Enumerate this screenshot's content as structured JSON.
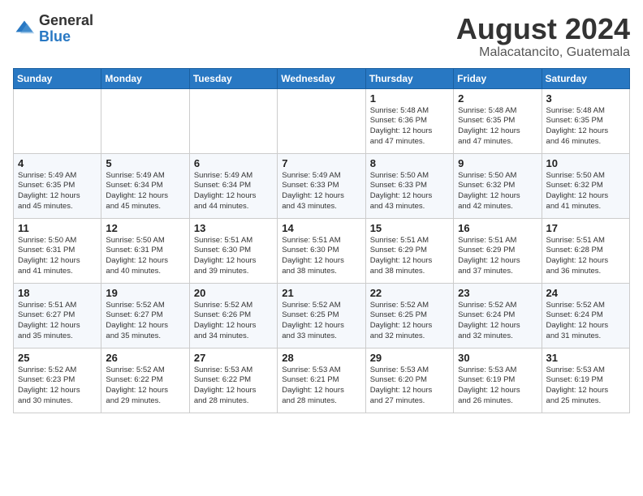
{
  "header": {
    "logo_general": "General",
    "logo_blue": "Blue",
    "month_year": "August 2024",
    "location": "Malacatancito, Guatemala"
  },
  "days_of_week": [
    "Sunday",
    "Monday",
    "Tuesday",
    "Wednesday",
    "Thursday",
    "Friday",
    "Saturday"
  ],
  "weeks": [
    [
      {
        "day": "",
        "detail": ""
      },
      {
        "day": "",
        "detail": ""
      },
      {
        "day": "",
        "detail": ""
      },
      {
        "day": "",
        "detail": ""
      },
      {
        "day": "1",
        "detail": "Sunrise: 5:48 AM\nSunset: 6:36 PM\nDaylight: 12 hours\nand 47 minutes."
      },
      {
        "day": "2",
        "detail": "Sunrise: 5:48 AM\nSunset: 6:35 PM\nDaylight: 12 hours\nand 47 minutes."
      },
      {
        "day": "3",
        "detail": "Sunrise: 5:48 AM\nSunset: 6:35 PM\nDaylight: 12 hours\nand 46 minutes."
      }
    ],
    [
      {
        "day": "4",
        "detail": "Sunrise: 5:49 AM\nSunset: 6:35 PM\nDaylight: 12 hours\nand 45 minutes."
      },
      {
        "day": "5",
        "detail": "Sunrise: 5:49 AM\nSunset: 6:34 PM\nDaylight: 12 hours\nand 45 minutes."
      },
      {
        "day": "6",
        "detail": "Sunrise: 5:49 AM\nSunset: 6:34 PM\nDaylight: 12 hours\nand 44 minutes."
      },
      {
        "day": "7",
        "detail": "Sunrise: 5:49 AM\nSunset: 6:33 PM\nDaylight: 12 hours\nand 43 minutes."
      },
      {
        "day": "8",
        "detail": "Sunrise: 5:50 AM\nSunset: 6:33 PM\nDaylight: 12 hours\nand 43 minutes."
      },
      {
        "day": "9",
        "detail": "Sunrise: 5:50 AM\nSunset: 6:32 PM\nDaylight: 12 hours\nand 42 minutes."
      },
      {
        "day": "10",
        "detail": "Sunrise: 5:50 AM\nSunset: 6:32 PM\nDaylight: 12 hours\nand 41 minutes."
      }
    ],
    [
      {
        "day": "11",
        "detail": "Sunrise: 5:50 AM\nSunset: 6:31 PM\nDaylight: 12 hours\nand 41 minutes."
      },
      {
        "day": "12",
        "detail": "Sunrise: 5:50 AM\nSunset: 6:31 PM\nDaylight: 12 hours\nand 40 minutes."
      },
      {
        "day": "13",
        "detail": "Sunrise: 5:51 AM\nSunset: 6:30 PM\nDaylight: 12 hours\nand 39 minutes."
      },
      {
        "day": "14",
        "detail": "Sunrise: 5:51 AM\nSunset: 6:30 PM\nDaylight: 12 hours\nand 38 minutes."
      },
      {
        "day": "15",
        "detail": "Sunrise: 5:51 AM\nSunset: 6:29 PM\nDaylight: 12 hours\nand 38 minutes."
      },
      {
        "day": "16",
        "detail": "Sunrise: 5:51 AM\nSunset: 6:29 PM\nDaylight: 12 hours\nand 37 minutes."
      },
      {
        "day": "17",
        "detail": "Sunrise: 5:51 AM\nSunset: 6:28 PM\nDaylight: 12 hours\nand 36 minutes."
      }
    ],
    [
      {
        "day": "18",
        "detail": "Sunrise: 5:51 AM\nSunset: 6:27 PM\nDaylight: 12 hours\nand 35 minutes."
      },
      {
        "day": "19",
        "detail": "Sunrise: 5:52 AM\nSunset: 6:27 PM\nDaylight: 12 hours\nand 35 minutes."
      },
      {
        "day": "20",
        "detail": "Sunrise: 5:52 AM\nSunset: 6:26 PM\nDaylight: 12 hours\nand 34 minutes."
      },
      {
        "day": "21",
        "detail": "Sunrise: 5:52 AM\nSunset: 6:25 PM\nDaylight: 12 hours\nand 33 minutes."
      },
      {
        "day": "22",
        "detail": "Sunrise: 5:52 AM\nSunset: 6:25 PM\nDaylight: 12 hours\nand 32 minutes."
      },
      {
        "day": "23",
        "detail": "Sunrise: 5:52 AM\nSunset: 6:24 PM\nDaylight: 12 hours\nand 32 minutes."
      },
      {
        "day": "24",
        "detail": "Sunrise: 5:52 AM\nSunset: 6:24 PM\nDaylight: 12 hours\nand 31 minutes."
      }
    ],
    [
      {
        "day": "25",
        "detail": "Sunrise: 5:52 AM\nSunset: 6:23 PM\nDaylight: 12 hours\nand 30 minutes."
      },
      {
        "day": "26",
        "detail": "Sunrise: 5:52 AM\nSunset: 6:22 PM\nDaylight: 12 hours\nand 29 minutes."
      },
      {
        "day": "27",
        "detail": "Sunrise: 5:53 AM\nSunset: 6:22 PM\nDaylight: 12 hours\nand 28 minutes."
      },
      {
        "day": "28",
        "detail": "Sunrise: 5:53 AM\nSunset: 6:21 PM\nDaylight: 12 hours\nand 28 minutes."
      },
      {
        "day": "29",
        "detail": "Sunrise: 5:53 AM\nSunset: 6:20 PM\nDaylight: 12 hours\nand 27 minutes."
      },
      {
        "day": "30",
        "detail": "Sunrise: 5:53 AM\nSunset: 6:19 PM\nDaylight: 12 hours\nand 26 minutes."
      },
      {
        "day": "31",
        "detail": "Sunrise: 5:53 AM\nSunset: 6:19 PM\nDaylight: 12 hours\nand 25 minutes."
      }
    ]
  ]
}
